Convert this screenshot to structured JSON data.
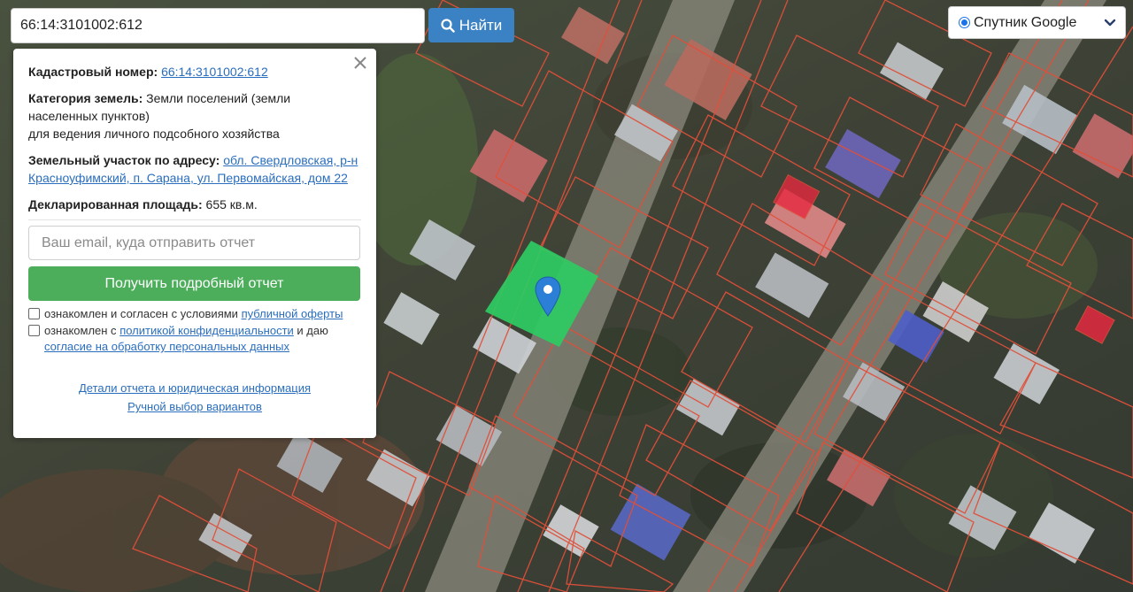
{
  "search": {
    "value": "66:14:3101002:612",
    "button_label": "Найти"
  },
  "layer": {
    "selected": "Спутник Google"
  },
  "parcel": {
    "cadastral_label": "Кадастровый номер:",
    "cadastral_number": "66:14:3101002:612",
    "category_label": "Категория земель:",
    "category_value": "Земли поселений (земли населенных пунктов)",
    "usage": "для ведения личного подсобного хозяйства",
    "address_label": "Земельный участок по адресу:",
    "address_value": "обл. Свердловская, р-н Красноуфимский, п. Сарана, ул. Первомайская, дом 22",
    "area_label": "Декларированная площадь:",
    "area_value": "655 кв.м."
  },
  "report": {
    "email_placeholder": "Ваш email, куда отправить отчет",
    "button_label": "Получить подробный отчет",
    "consent1_text": "ознакомлен и согласен с условиями ",
    "consent1_link": "публичной оферты",
    "consent2_text": "ознакомлен с ",
    "consent2_link": "политикой конфиденциальности",
    "consent2_mid": " и даю",
    "consent2_link2": "согласие на обработку персональных данных"
  },
  "footer": {
    "details_link": "Детали отчета и юридическая информация",
    "manual_link": "Ручной выбор вариантов"
  },
  "colors": {
    "search_button": "#3b82c4",
    "report_button": "#4cae5b",
    "selected_parcel": "#2ecc63",
    "parcel_borders": "#e0503a",
    "link": "#2a6ebd"
  },
  "icons": {
    "search": "search-icon",
    "close": "close-icon",
    "layer_chevron": "chevron-down-icon",
    "marker": "map-marker-icon"
  }
}
